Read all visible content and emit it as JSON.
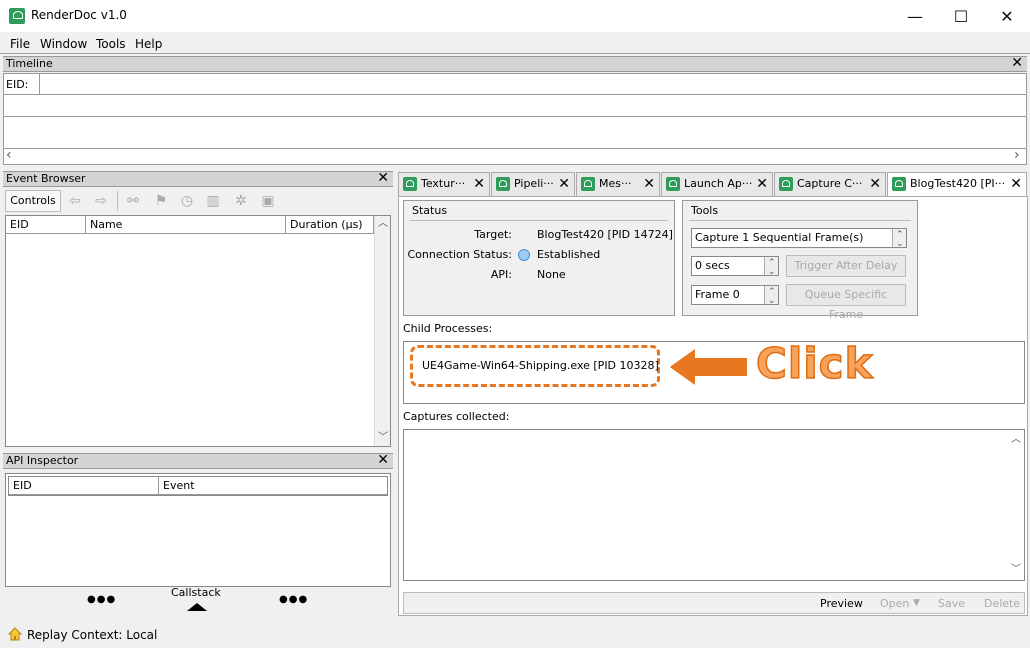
{
  "window": {
    "title": "RenderDoc v1.0",
    "minimize": "—",
    "maximize": "☐",
    "close": "✕"
  },
  "menu": [
    "File",
    "Window",
    "Tools",
    "Help"
  ],
  "timeline": {
    "title": "Timeline",
    "eid_label": "EID:"
  },
  "event_browser": {
    "title": "Event Browser",
    "controls_label": "Controls",
    "columns": [
      "EID",
      "Name",
      "Duration (µs)"
    ]
  },
  "api_inspector": {
    "title": "API Inspector",
    "columns": [
      "EID",
      "Event"
    ],
    "callstack_label": "Callstack",
    "dots": "●●●"
  },
  "tabs": [
    {
      "label": "Textur···"
    },
    {
      "label": "Pipeli···"
    },
    {
      "label": "Mes···"
    },
    {
      "label": "Launch Ap···"
    },
    {
      "label": "Capture C···"
    },
    {
      "label": "BlogTest420 [PI···",
      "active": true
    }
  ],
  "status_group": {
    "title": "Status",
    "target_label": "Target:",
    "target_value": "BlogTest420 [PID 14724]",
    "connection_label": "Connection Status:",
    "connection_value": "Established",
    "api_label": "API:",
    "api_value": "None"
  },
  "tools_group": {
    "title": "Tools",
    "capture_mode": "Capture 1 Sequential Frame(s)",
    "delay_value": "0 secs",
    "trigger_button": "Trigger After Delay",
    "frame_value": "Frame 0",
    "queue_button": "Queue Specific Frame"
  },
  "child_processes": {
    "label": "Child Processes:",
    "items": [
      "UE4Game-Win64-Shipping.exe [PID 10328]"
    ]
  },
  "annotation": {
    "text": "Click",
    "color": "#e87722"
  },
  "captures": {
    "label": "Captures collected:"
  },
  "bottom_actions": {
    "preview": "Preview",
    "open": "Open",
    "save": "Save",
    "delete": "Delete"
  },
  "statusbar": {
    "text": "Replay Context: Local"
  }
}
